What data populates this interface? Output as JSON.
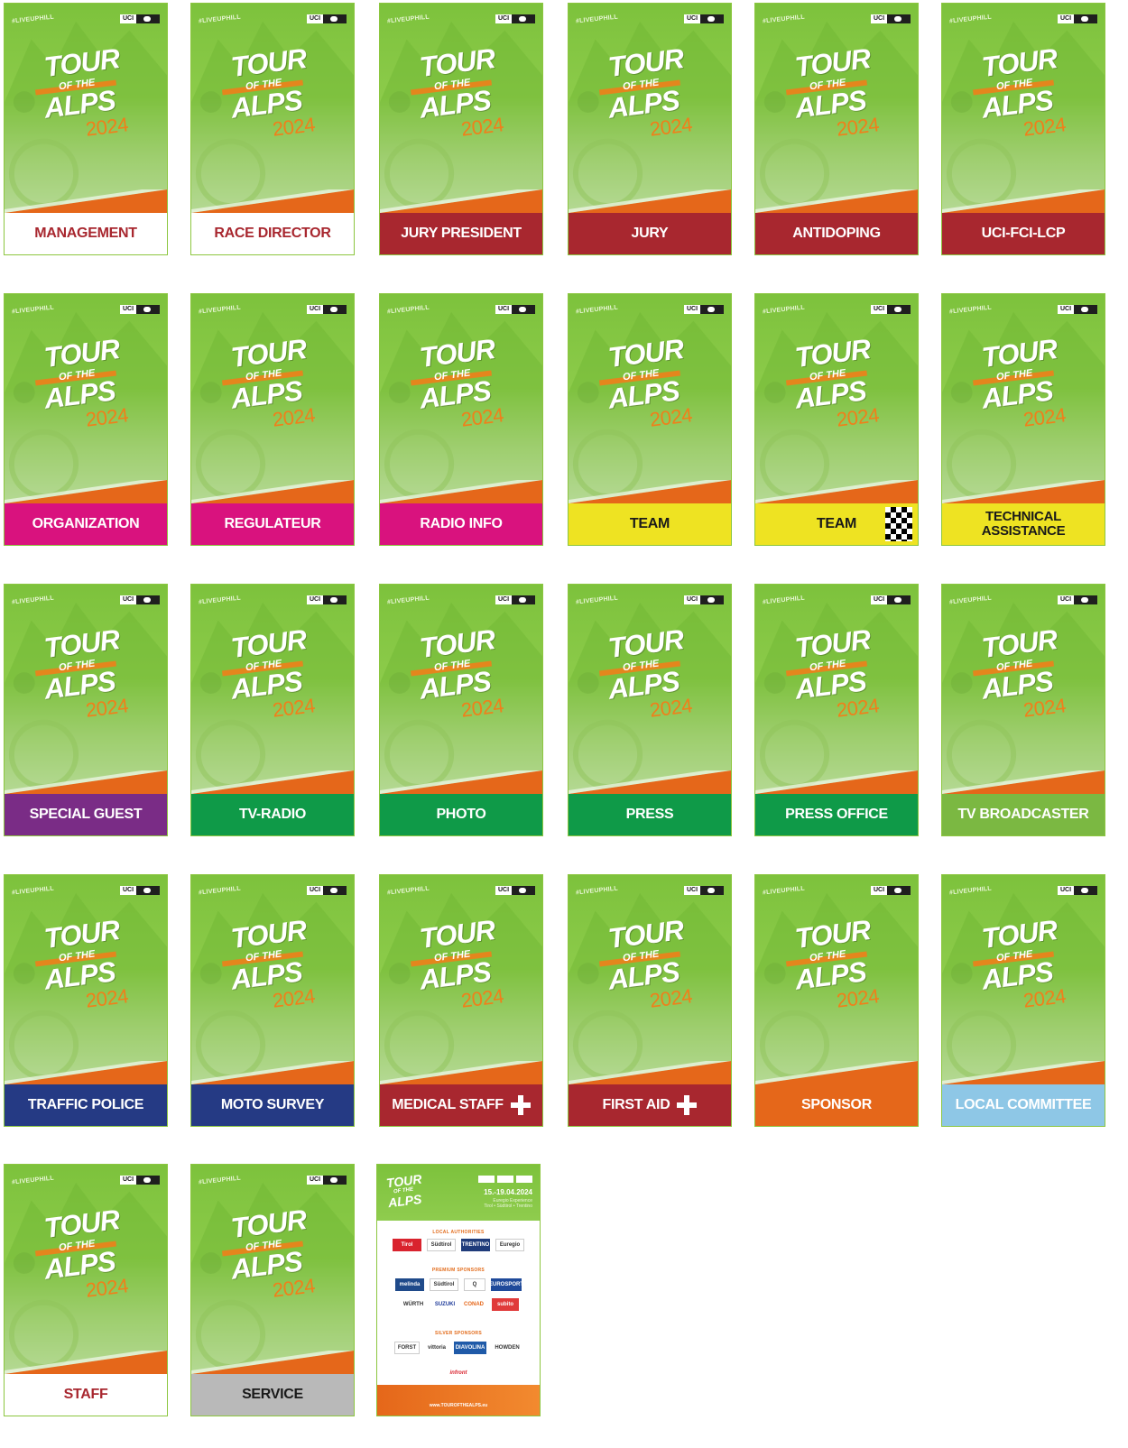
{
  "card_common": {
    "hashtag": "#LIVEUPHILL",
    "uci": "UCI",
    "tour": "TOUR",
    "of_the": "OF THE",
    "alps": "ALPS",
    "year": "2024"
  },
  "badges": [
    {
      "label": "MANAGEMENT",
      "bg": "#ffffff",
      "fg": "#a8272f"
    },
    {
      "label": "RACE DIRECTOR",
      "bg": "#ffffff",
      "fg": "#a8272f"
    },
    {
      "label": "JURY PRESIDENT",
      "bg": "#a8272f",
      "fg": "#ffffff"
    },
    {
      "label": "JURY",
      "bg": "#a8272f",
      "fg": "#ffffff"
    },
    {
      "label": "ANTIDOPING",
      "bg": "#a8272f",
      "fg": "#ffffff"
    },
    {
      "label": "UCI-FCI-LCP",
      "bg": "#a8272f",
      "fg": "#ffffff"
    },
    {
      "label": "ORGANIZATION",
      "bg": "#d9127e",
      "fg": "#ffffff"
    },
    {
      "label": "REGULATEUR",
      "bg": "#d9127e",
      "fg": "#ffffff"
    },
    {
      "label": "RADIO INFO",
      "bg": "#d9127e",
      "fg": "#ffffff"
    },
    {
      "label": "TEAM",
      "bg": "#eee322",
      "fg": "#1a1a1a"
    },
    {
      "label": "TEAM",
      "bg": "#eee322",
      "fg": "#1a1a1a",
      "icon": "checkered-flag-icon"
    },
    {
      "label": "TECHNICAL\nASSISTANCE",
      "bg": "#eee322",
      "fg": "#1a1a1a"
    },
    {
      "label": "SPECIAL GUEST",
      "bg": "#7a2c86",
      "fg": "#ffffff"
    },
    {
      "label": "TV-RADIO",
      "bg": "#0f9a48",
      "fg": "#ffffff"
    },
    {
      "label": "PHOTO",
      "bg": "#0f9a48",
      "fg": "#ffffff"
    },
    {
      "label": "PRESS",
      "bg": "#0f9a48",
      "fg": "#ffffff"
    },
    {
      "label": "PRESS OFFICE",
      "bg": "#0f9a48",
      "fg": "#ffffff"
    },
    {
      "label": "TV BROADCASTER",
      "bg": "#7bb842",
      "fg": "#ffffff"
    },
    {
      "label": "TRAFFIC POLICE",
      "bg": "#253a84",
      "fg": "#ffffff"
    },
    {
      "label": "MOTO SURVEY",
      "bg": "#253a84",
      "fg": "#ffffff"
    },
    {
      "label": "MEDICAL STAFF",
      "bg": "#a8272f",
      "fg": "#ffffff",
      "icon": "medical-cross-icon"
    },
    {
      "label": "FIRST AID",
      "bg": "#a8272f",
      "fg": "#ffffff",
      "icon": "medical-cross-icon"
    },
    {
      "label": "SPONSOR",
      "bg": "#e5671a",
      "fg": "#ffffff"
    },
    {
      "label": "LOCAL COMMITTEE",
      "bg": "#8ec7e6",
      "fg": "#ffffff"
    },
    {
      "label": "STAFF",
      "bg": "#ffffff",
      "fg": "#a8272f"
    },
    {
      "label": "SERVICE",
      "bg": "#b9b9b9",
      "fg": "#1a1a1a"
    }
  ],
  "sponsor_panel": {
    "tour": "TOUR",
    "of_the": "OF THE",
    "alps": "ALPS",
    "dates": "15.-19.04.2024",
    "region_line1": "Euregio Experience",
    "region_line2": "Tirol • Südtirol • Trentino",
    "local_authorities": "LOCAL AUTHORITIES",
    "local_logos": [
      "Tirol",
      "Südtirol",
      "TRENTINO",
      "Euregio"
    ],
    "premium_sponsors": "PREMIUM SPONSORS",
    "premium_row1": [
      "melinda",
      "Südtirol",
      "Q",
      "EUROSPORT"
    ],
    "premium_row2": [
      "WÜRTH",
      "SUZUKI",
      "CONAD",
      "subito"
    ],
    "silver_sponsors": "SILVER SPONSORS",
    "silver_logos": [
      "FORST",
      "vittoria",
      "DIAVOLINA",
      "HOWDEN"
    ],
    "extra_logo": "infront",
    "url": "www.TOUROFTHEALPS.eu"
  }
}
